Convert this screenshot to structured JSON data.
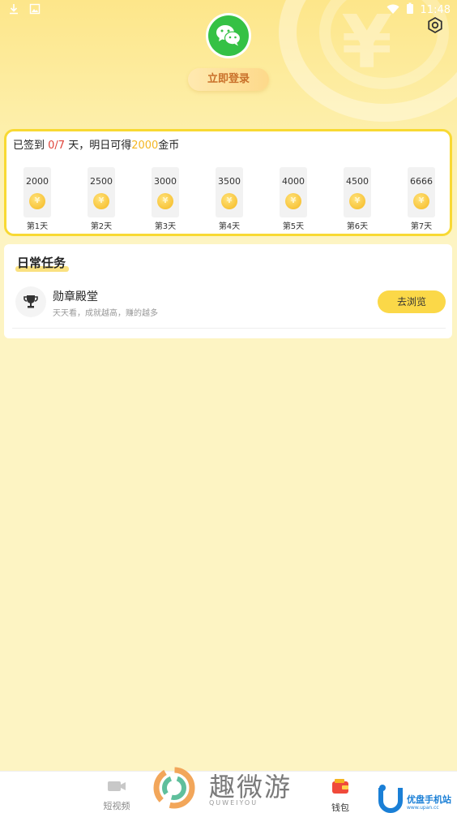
{
  "status_bar": {
    "time": "11:48",
    "icons": [
      "download-icon",
      "image-icon",
      "wifi-icon",
      "battery-icon"
    ]
  },
  "header": {
    "avatar_icon": "wechat-icon",
    "login_label": "立即登录",
    "settings_icon": "settings-icon"
  },
  "signin": {
    "title_prefix": "已签到 ",
    "signed": "0/7",
    "title_mid": " 天，明日可得",
    "tomorrow_reward": "2000",
    "title_suffix": "金币",
    "days": [
      {
        "amount": "2000",
        "label": "第1天"
      },
      {
        "amount": "2500",
        "label": "第2天"
      },
      {
        "amount": "3000",
        "label": "第3天"
      },
      {
        "amount": "3500",
        "label": "第4天"
      },
      {
        "amount": "4000",
        "label": "第5天"
      },
      {
        "amount": "4500",
        "label": "第6天"
      },
      {
        "amount": "6666",
        "label": "第7天"
      }
    ]
  },
  "tasks": {
    "title": "日常任务",
    "items": [
      {
        "icon": "trophy-icon",
        "name": "勋章殿堂",
        "desc": "天天看，成就越高，赚的越多",
        "button": "去浏览"
      }
    ]
  },
  "bottom_nav": {
    "items": [
      {
        "icon": "video-camera-icon",
        "label": "短视频"
      },
      {
        "icon": "wallet-icon",
        "label": "钱包"
      }
    ],
    "brand": {
      "name": "趣微游",
      "sub": "QUWEIYOU"
    },
    "site": {
      "name": "优盘手机站",
      "url": "www.upan.cc"
    }
  },
  "colors": {
    "accent_yellow": "#fbd848",
    "highlight_red": "#e0433a",
    "highlight_gold": "#f3b623",
    "wechat_green": "#35c145"
  }
}
